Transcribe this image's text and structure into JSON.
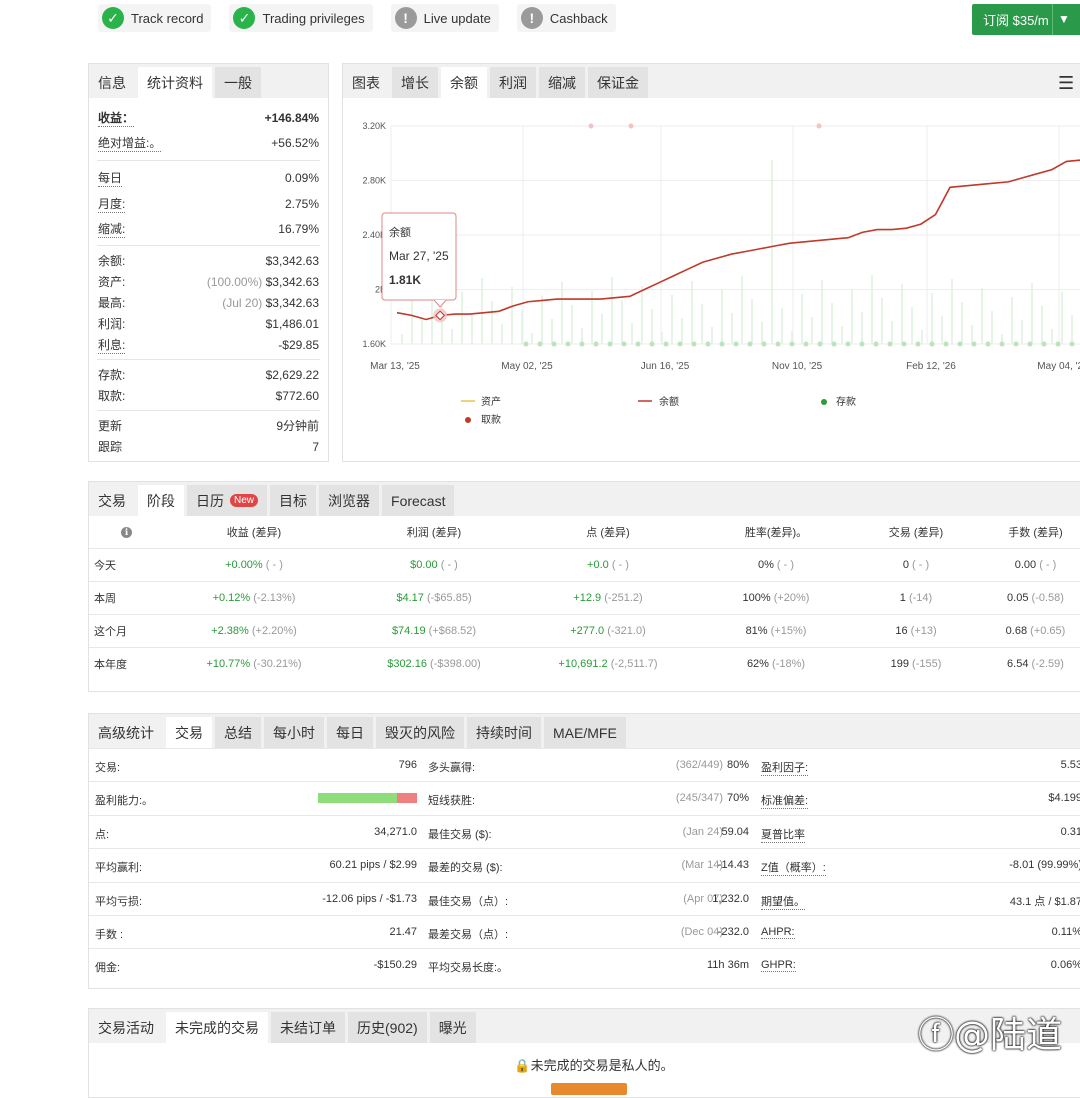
{
  "badges": [
    {
      "label": "Track record",
      "status": "ok"
    },
    {
      "label": "Trading privileges",
      "status": "ok"
    },
    {
      "label": "Live update",
      "status": "warn"
    },
    {
      "label": "Cashback",
      "status": "warn"
    }
  ],
  "subscribe": {
    "label": "订阅 $35/m"
  },
  "stats": {
    "tabs": [
      "信息",
      "统计资料",
      "一般"
    ],
    "gain_label": "收益：",
    "gain_value": "+146.84%",
    "abs_gain_label": "绝对增益:。",
    "abs_gain_value": "+56.52%",
    "daily_label": "每日",
    "daily_value": "0.09%",
    "monthly_label": "月度:",
    "monthly_value": "2.75%",
    "drawdown_label": "缩减:",
    "drawdown_value": "16.79%",
    "balance_label": "余额:",
    "balance_value": "$3,342.63",
    "equity_label": "资产:",
    "equity_note": "(100.00%)",
    "equity_value": "$3,342.63",
    "highest_label": "最高:",
    "highest_note": "(Jul 20)",
    "highest_value": "$3,342.63",
    "profit_label": "利润:",
    "profit_value": "$1,486.01",
    "interest_label": "利息:",
    "interest_value": "-$29.85",
    "deposits_label": "存款:",
    "deposits_value": "$2,629.22",
    "withdrawals_label": "取款:",
    "withdrawals_value": "$772.60",
    "updated_label": "更新",
    "updated_value": "9分钟前",
    "tracking_label": "跟踪",
    "tracking_value": "7"
  },
  "chart": {
    "tabs": [
      "图表",
      "增长",
      "余额",
      "利润",
      "缩减",
      "保证金"
    ],
    "tooltip": {
      "title": "余额",
      "date": "Mar 27, '25",
      "value": "1.81K"
    },
    "legend": {
      "equity": "资产",
      "balance": "余额",
      "deposit": "存款",
      "withdrawal": "取款"
    },
    "colors": {
      "balance": "#c0392b",
      "equity": "#e8c34a",
      "deposit": "#2a9a3a",
      "withdrawal": "#c0392b"
    }
  },
  "chart_data": {
    "type": "line",
    "title": "",
    "x_ticks": [
      "Mar 13, '25",
      "May 02, '25",
      "Jun 16, '25",
      "Nov 10, '25",
      "Feb 12, '26",
      "May 04, '26"
    ],
    "y_ticks": [
      "1.60K",
      "2K",
      "2.40K",
      "2.80K",
      "3.20K"
    ],
    "ylim": [
      1600,
      3200
    ],
    "series": [
      {
        "name": "余额",
        "values": [
          1830,
          1810,
          1780,
          1810,
          1820,
          1820,
          1830,
          1840,
          1880,
          1910,
          1920,
          1930,
          1930,
          1930,
          1930,
          1940,
          1950,
          2000,
          2050,
          2100,
          2150,
          2200,
          2230,
          2260,
          2280,
          2300,
          2320,
          2340,
          2350,
          2360,
          2370,
          2380,
          2420,
          2440,
          2440,
          2450,
          2480,
          2550,
          2750,
          2760,
          2770,
          2780,
          2790,
          2820,
          2850,
          2880,
          2940,
          2950
        ]
      }
    ]
  },
  "periods": {
    "tabs": [
      "交易",
      "阶段",
      "日历",
      "目标",
      "浏览器",
      "Forecast"
    ],
    "calendar_badge": "New",
    "info_icon": "ℹ",
    "headers": [
      "收益 (差异)",
      "利润 (差异)",
      "点 (差异)",
      "胜率(差异)。",
      "交易 (差异)",
      "手数 (差异)"
    ],
    "rows": [
      {
        "label": "今天",
        "gain": "+0.00%",
        "gain_d": "( - )",
        "profit": "$0.00",
        "profit_d": "( - )",
        "pips": "+0.0",
        "pips_d": "( - )",
        "win": "0%",
        "win_d": "( - )",
        "trades": "0",
        "trades_d": "( - )",
        "lots": "0.00",
        "lots_d": "( - )"
      },
      {
        "label": "本周",
        "gain": "+0.12%",
        "gain_d": "(-2.13%)",
        "profit": "$4.17",
        "profit_d": "(-$65.85)",
        "pips": "+12.9",
        "pips_d": "(-251.2)",
        "win": "100%",
        "win_d": "(+20%)",
        "trades": "1",
        "trades_d": "(-14)",
        "lots": "0.05",
        "lots_d": "(-0.58)"
      },
      {
        "label": "这个月",
        "gain": "+2.38%",
        "gain_d": "(+2.20%)",
        "profit": "$74.19",
        "profit_d": "(+$68.52)",
        "pips": "+277.0",
        "pips_d": "(-321.0)",
        "win": "81%",
        "win_d": "(+15%)",
        "trades": "16",
        "trades_d": "(+13)",
        "lots": "0.68",
        "lots_d": "(+0.65)"
      },
      {
        "label": "本年度",
        "gain": "+10.77%",
        "gain_d": "(-30.21%)",
        "profit": "$302.16",
        "profit_d": "(-$398.00)",
        "pips": "+10,691.2",
        "pips_d": "(-2,511.7)",
        "win": "62%",
        "win_d": "(-18%)",
        "trades": "199",
        "trades_d": "(-155)",
        "lots": "6.54",
        "lots_d": "(-2.59)"
      }
    ]
  },
  "advanced": {
    "tabs": [
      "高级统计",
      "交易",
      "总结",
      "每小时",
      "每日",
      "毁灭的风险",
      "持续时间",
      "MAE/MFE"
    ],
    "rows": [
      {
        "l1": "交易:",
        "v1": "796",
        "l2": "多头赢得:",
        "n2": "(362/449)",
        "v2": "80%",
        "l3": "盈利因子:",
        "v3": "5.53"
      },
      {
        "l1": "盈利能力:。",
        "v1": "",
        "l2": "短线获胜:",
        "n2": "(245/347)",
        "v2": "70%",
        "l3": "标准偏差:",
        "v3": "$4.199"
      },
      {
        "l1": "点:",
        "v1": "34,271.0",
        "l2": "最佳交易 ($):",
        "n2": "(Jan 24)",
        "v2": "59.04",
        "l3": "夏普比率",
        "v3": "0.31"
      },
      {
        "l1": "平均赢利:",
        "v1": "60.21 pips / $2.99",
        "l2": "最差的交易 ($):",
        "n2": "(Mar 14)",
        "v2": "-14.43",
        "l3": "Z值（概率）:",
        "v3": "-8.01 (99.99%)"
      },
      {
        "l1": "平均亏损:",
        "v1": "-12.06 pips / -$1.73",
        "l2": "最佳交易（点）:",
        "n2": "(Apr 07)",
        "v2": "1,232.0",
        "l3": "期望值。",
        "v3": "43.1 点 / $1.87"
      },
      {
        "l1": "手数 :",
        "v1": "21.47",
        "l2": "最差交易（点）:",
        "n2": "(Dec 04)",
        "v2": "-232.0",
        "l3": "AHPR:",
        "v3": "0.11%"
      },
      {
        "l1": "佣金:",
        "v1": "-$150.29",
        "l2": "平均交易长度:。",
        "n2": "",
        "v2": "11h 36m",
        "l3": "GHPR:",
        "v3": "0.06%"
      }
    ],
    "profitability": {
      "win_fraction": 0.8
    }
  },
  "activity": {
    "tabs": [
      "交易活动",
      "未完成的交易",
      "未结订单",
      "历史(902)",
      "曝光"
    ],
    "private_text": "未完成的交易是私人的。"
  },
  "watermark": "ⓕ@陆道"
}
